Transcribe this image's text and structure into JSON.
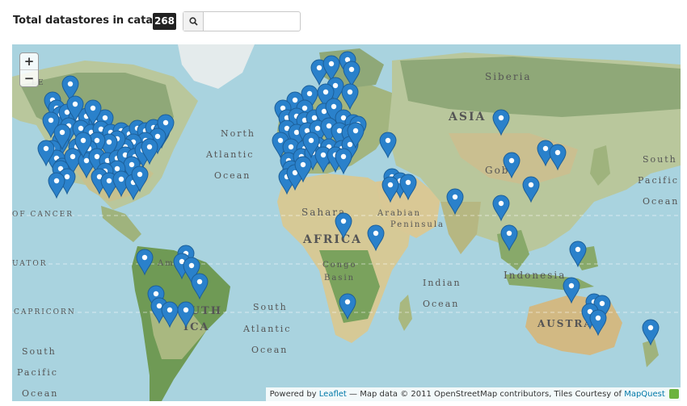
{
  "header": {
    "total_label": "Total datastores in catalog",
    "total_count": "268",
    "search": {
      "value": "",
      "placeholder": ""
    }
  },
  "map": {
    "zoom_in": "+",
    "zoom_out": "−",
    "marker_color": "#2a81cb",
    "labels": {
      "siberia": "Siberia",
      "asia": "ASIA",
      "north": "North",
      "atlantic": "Atlantic",
      "ocean": "Ocean",
      "sahara": "Sahara",
      "arabian": "Arabian",
      "peninsula": "Peninsula",
      "africa": "AFRICA",
      "congo": "Congo",
      "basin": "Basin",
      "indian": "Indian",
      "indian_ocean": "Ocean",
      "indonesia": "Indonesia",
      "gobi": "Gob",
      "south": "South",
      "south_atlantic": "Atlantic",
      "south_ocean": "Ocean",
      "south_america_1": "SOUTH",
      "south_america_2": "ICA",
      "amazon": "Amaz",
      "australia": "AUSTRAL",
      "cancer": "OF CANCER",
      "equator": "UATOR",
      "capricorn": "CAPRICORN",
      "pacific_south": "South",
      "pacific": "Pacific",
      "pacific_ocean": "Ocean",
      "north_pacific_1": "South",
      "north_pacific_2": "Pacific",
      "north_pacific_3": "Ocean",
      "nl": "LE"
    }
  },
  "attribution": {
    "powered_by": "Powered by",
    "leaflet": "Leaflet",
    "map_data": "— Map data © 2011 OpenStreetMap contributors, Tiles Courtesy of",
    "mapquest": "MapQuest"
  }
}
